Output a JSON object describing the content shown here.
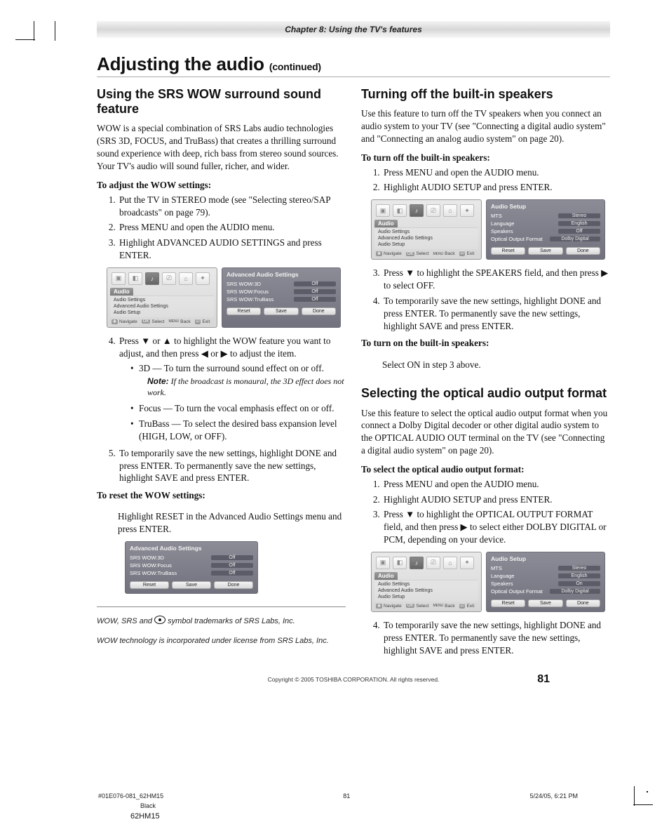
{
  "chapter_header": "Chapter 8: Using the TV's features",
  "title_main": "Adjusting the audio ",
  "title_cont": "(continued)",
  "page_number": "81",
  "copyright": "Copyright © 2005 TOSHIBA CORPORATION. All rights reserved.",
  "prefoot": {
    "file": "#01E076-081_62HM15",
    "page": "81",
    "date": "5/24/05, 6:21 PM"
  },
  "color_line": "Black",
  "model": "62HM15",
  "trademarks": {
    "line1a": "WOW, SRS and ",
    "line1b": " symbol trademarks of SRS Labs, Inc.",
    "line2": "WOW technology is incorporated under license from SRS Labs, Inc."
  },
  "left": {
    "h": "Using the SRS WOW surround sound feature",
    "intro": "WOW is a special combination of SRS Labs audio technologies (SRS 3D, FOCUS, and TruBass) that creates a thrilling surround sound experience with deep, rich bass from stereo sound sources. Your TV's audio will sound fuller, richer, and wider.",
    "lead1": "To adjust the WOW settings:",
    "s1": "Put the TV in STEREO mode (see \"Selecting stereo/SAP broadcasts\" on page 79).",
    "s2": "Press MENU and open the AUDIO menu.",
    "s3": "Highlight ADVANCED AUDIO SETTINGS and press ENTER.",
    "s4a": "Press ",
    "s4b": " or ",
    "s4c": " to highlight the WOW feature you want to adjust, and then press ",
    "s4d": " or ",
    "s4e": " to adjust the item.",
    "b1": "3D — To turn the surround sound effect on or off.",
    "note_label": "Note:",
    "note": " If the broadcast is monaural, the 3D effect does not work.",
    "b2": "Focus — To turn the vocal emphasis effect on or off.",
    "b3": "TruBass  — To select the desired bass expansion level (HIGH, LOW, or OFF).",
    "s5": "To temporarily save the new settings, highlight DONE and press ENTER. To permanently save the new settings, highlight SAVE and press ENTER.",
    "lead2": "To reset the WOW settings:",
    "reset": "Highlight RESET in the Advanced Audio Settings menu and press ENTER."
  },
  "right": {
    "h1": "Turning off the built-in speakers",
    "intro1": "Use this feature to turn off the TV speakers when you connect an audio system to your TV (see \"Connecting a digital audio system\" and \"Connecting an analog audio system\" on page 20).",
    "lead1": "To turn off the built-in speakers:",
    "r1s1": "Press MENU and open the AUDIO menu.",
    "r1s2": "Highlight AUDIO SETUP and press ENTER.",
    "r1s3a": "Press ",
    "r1s3b": " to highlight the SPEAKERS field, and then press ",
    "r1s3c": " to select OFF.",
    "r1s4": "To temporarily save the new settings, highlight DONE and press ENTER. To permanently save the new settings, highlight SAVE and press ENTER.",
    "lead2": "To turn on the built-in speakers:",
    "on": "Select ON in step 3 above.",
    "h2": "Selecting the optical audio output format",
    "intro2": "Use this feature to select the optical audio output format when you connect a Dolby Digital decoder or other digital audio system to the OPTICAL AUDIO OUT terminal on the TV (see \"Connecting a digital audio system\" on page 20).",
    "lead3": "To select the optical audio output format:",
    "r2s1": "Press MENU and open the AUDIO menu.",
    "r2s2": "Highlight AUDIO SETUP and press ENTER.",
    "r2s3a": "Press ",
    "r2s3b": " to highlight the OPTICAL OUTPUT FORMAT field, and then press ",
    "r2s3c": " to select either DOLBY DIGITAL or PCM, depending on your device.",
    "r2s4": "To temporarily save the new settings, highlight DONE and press ENTER. To permanently save the new settings, highlight SAVE and press ENTER."
  },
  "osd": {
    "audio_tab": "Audio",
    "menu_items": [
      "Audio Settings",
      "Advanced Audio Settings",
      "Audio Setup"
    ],
    "nav": {
      "navigate": "Navigate",
      "select": "Select",
      "back": "Back",
      "exit": "Exit",
      "menu": "MENU"
    },
    "adv_title": "Advanced Audio Settings",
    "adv_rows": [
      {
        "k": "SRS WOW:3D",
        "v": "Off"
      },
      {
        "k": "SRS WOW:Focus",
        "v": "Off"
      },
      {
        "k": "SRS WOW:TruBass",
        "v": "Off"
      }
    ],
    "btns": {
      "reset": "Reset",
      "save": "Save",
      "done": "Done"
    },
    "setup_title": "Audio Setup",
    "setup_rows": [
      {
        "k": "MTS",
        "v": "Stereo"
      },
      {
        "k": "Language",
        "v": "English"
      },
      {
        "k": "Speakers",
        "v": "Off"
      },
      {
        "k": "Optical Output Format",
        "v": "Dolby Digital"
      }
    ],
    "setup_rows2": [
      {
        "k": "MTS",
        "v": "Stereo"
      },
      {
        "k": "Language",
        "v": "English"
      },
      {
        "k": "Speakers",
        "v": "On"
      },
      {
        "k": "Optical Output Format",
        "v": "Dolby Digital"
      }
    ]
  }
}
